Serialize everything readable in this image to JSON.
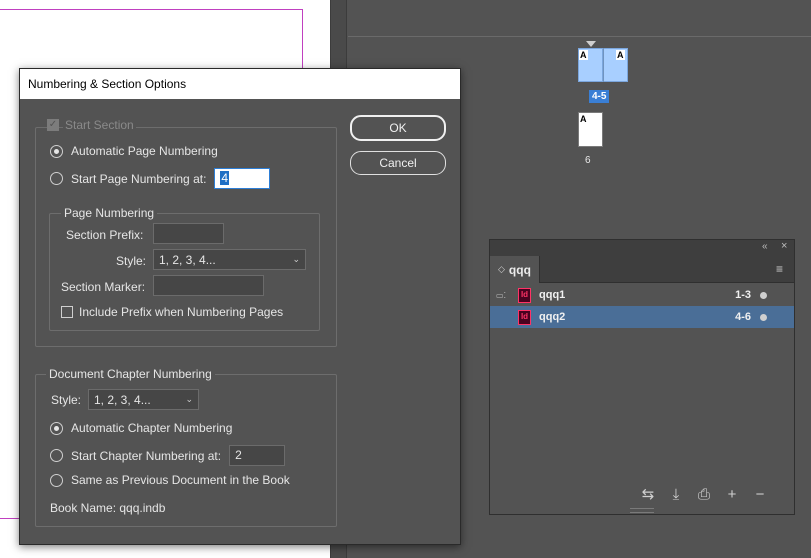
{
  "pages_panel": {
    "spreads": [
      {
        "label": "4-5",
        "masters": [
          "A",
          "A"
        ]
      },
      {
        "label": "6",
        "masters": [
          "A"
        ]
      }
    ]
  },
  "book_panel": {
    "tab_title": "qqq",
    "documents": [
      {
        "name": "qqq1",
        "pages": "1-3",
        "selected": false
      },
      {
        "name": "qqq2",
        "pages": "4-6",
        "selected": true
      }
    ],
    "icons": {
      "collapse": "double-chevron-icon",
      "close": "close-icon",
      "menu": "hamburger-menu-icon",
      "sync": "synchronize-icon",
      "save": "save-book-icon",
      "print": "print-icon",
      "add": "add-document-icon",
      "remove": "remove-document-icon"
    },
    "id_icon_label": "Id"
  },
  "dialog": {
    "title": "Numbering & Section Options",
    "start_section_label": "Start Section",
    "auto_page_label": "Automatic Page Numbering",
    "start_page_label": "Start Page Numbering at:",
    "start_page_value": "4",
    "page_numbering_group": "Page Numbering",
    "section_prefix_label": "Section Prefix:",
    "section_prefix_value": "",
    "style_label": "Style:",
    "style_value": "1, 2, 3, 4...",
    "section_marker_label": "Section Marker:",
    "section_marker_value": "",
    "include_prefix_label": "Include Prefix when Numbering Pages",
    "chapter_group": "Document Chapter Numbering",
    "chapter_style_label": "Style:",
    "chapter_style_value": "1, 2, 3, 4...",
    "auto_chapter_label": "Automatic Chapter Numbering",
    "start_chapter_label": "Start Chapter Numbering at:",
    "start_chapter_value": "2",
    "same_as_prev_label": "Same as Previous Document in the Book",
    "book_name_label": "Book Name: qqq.indb",
    "ok_label": "OK",
    "cancel_label": "Cancel"
  },
  "colors": {
    "ui_background": "#535353",
    "selection_blue": "#4a6e97",
    "focus_blue": "#2d7ed6",
    "indesign_pink": "#ff3366"
  }
}
